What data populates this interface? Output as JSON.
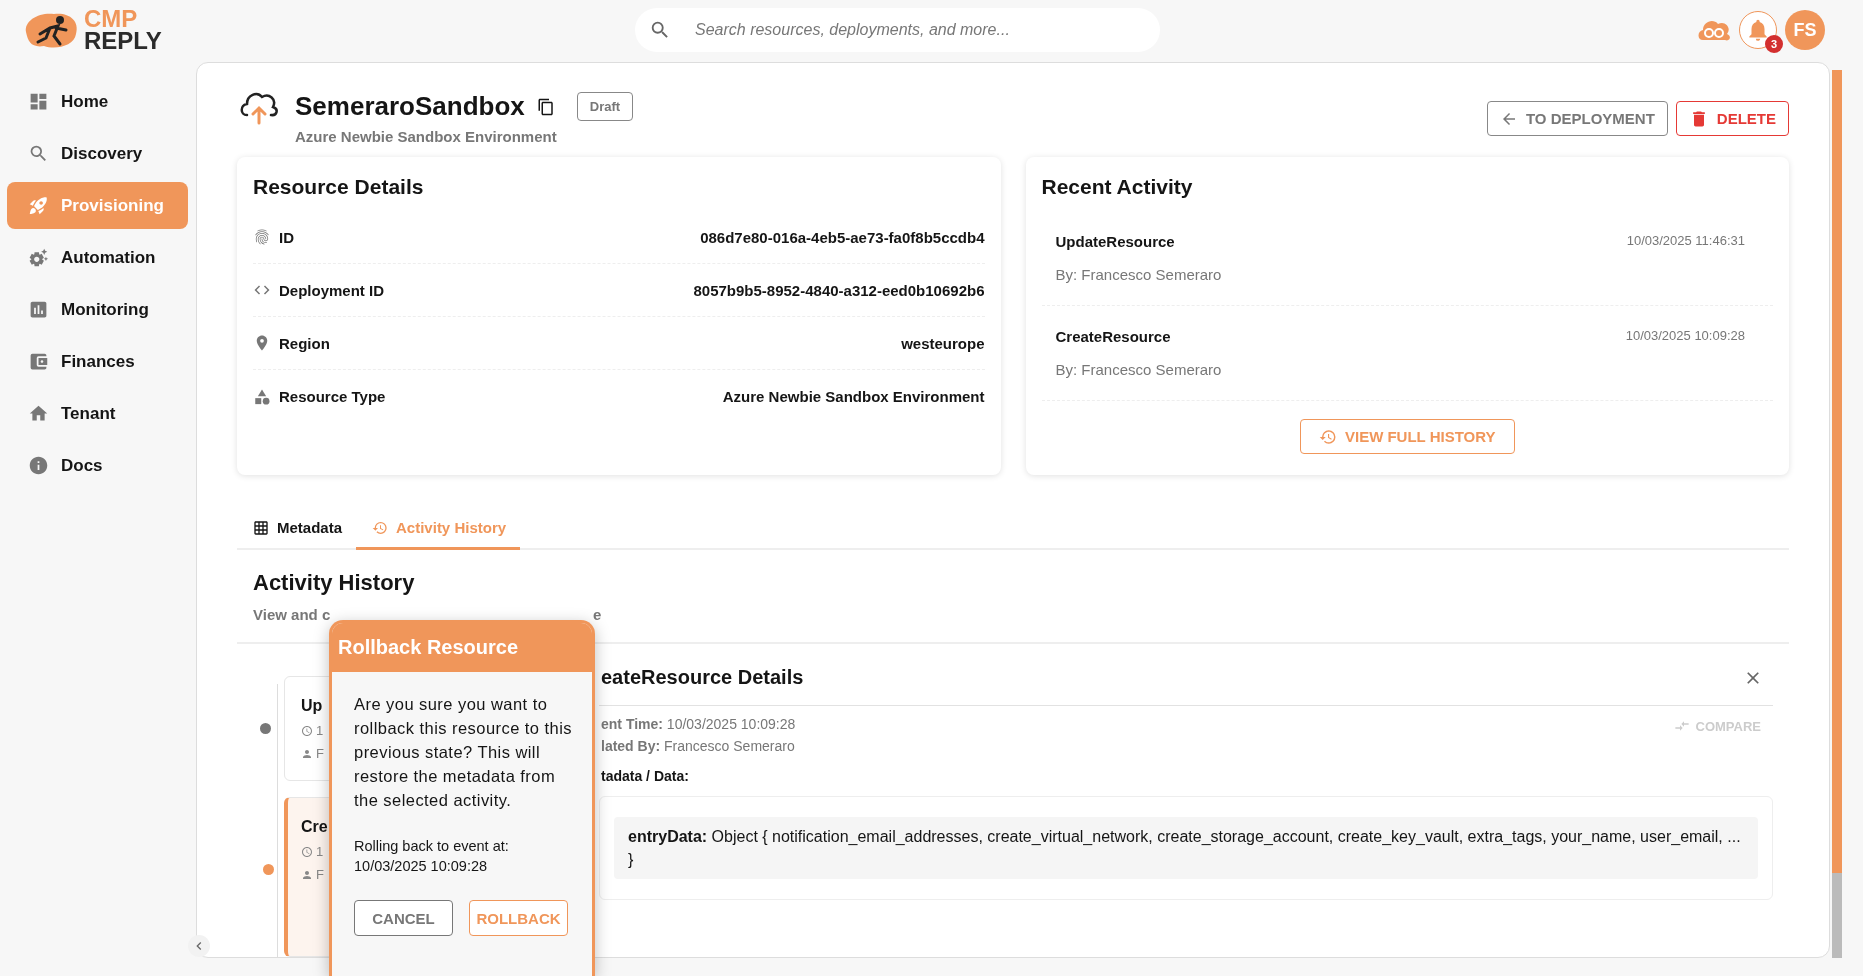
{
  "logo": {
    "top": "CMP",
    "bottom": "REPLY"
  },
  "search": {
    "placeholder": "Search resources, deployments, and more..."
  },
  "topbar": {
    "notification_count": "3",
    "avatar": "FS"
  },
  "sidebar": {
    "items": [
      {
        "label": "Home",
        "selected": false
      },
      {
        "label": "Discovery",
        "selected": false
      },
      {
        "label": "Provisioning",
        "selected": true
      },
      {
        "label": "Automation",
        "selected": false
      },
      {
        "label": "Monitoring",
        "selected": false
      },
      {
        "label": "Finances",
        "selected": false
      },
      {
        "label": "Tenant",
        "selected": false
      },
      {
        "label": "Docs",
        "selected": false
      }
    ]
  },
  "resource": {
    "title": "SemeraroSandbox",
    "status": "Draft",
    "subtitle": "Azure Newbie Sandbox Environment"
  },
  "actions": [
    {
      "label": "TO DEPLOYMENT",
      "kind": "back"
    },
    {
      "label": "DELETE",
      "kind": "danger"
    }
  ],
  "resource_details": {
    "title": "Resource Details",
    "rows": [
      {
        "label": "ID",
        "value": "086d7e80-016a-4eb5-ae73-fa0f8b5ccdb4"
      },
      {
        "label": "Deployment ID",
        "value": "8057b9b5-8952-4840-a312-eed0b10692b6"
      },
      {
        "label": "Region",
        "value": "westeurope"
      },
      {
        "label": "Resource Type",
        "value": "Azure Newbie Sandbox Environment"
      }
    ]
  },
  "recent_activity": {
    "title": "Recent Activity",
    "items": [
      {
        "name": "UpdateResource",
        "time": "10/03/2025 11:46:31",
        "by": "By: Francesco Semeraro"
      },
      {
        "name": "CreateResource",
        "time": "10/03/2025 10:09:28",
        "by": "By: Francesco Semeraro"
      }
    ],
    "button": "VIEW FULL HISTORY"
  },
  "tabs": [
    {
      "label": "Metadata",
      "selected": false
    },
    {
      "label": "Activity History",
      "selected": true
    }
  ],
  "activity_history": {
    "title": "Activity History",
    "subtitle_parts": [
      "View and c",
      "e"
    ],
    "timeline": [
      {
        "title": "Up",
        "time": "1",
        "user": "F",
        "selected": false
      },
      {
        "title": "Cre",
        "time": "1",
        "user": "F",
        "selected": true
      }
    ],
    "details": {
      "title": "eateResource Details",
      "event_time": "**ent Time:** 10/03/2025 10:09:28",
      "created_by": "**lated By:** Francesco Semeraro",
      "metadata_label": "tadata / Data:",
      "compare": {
        "label": "COMPARE",
        "disabled": true
      },
      "entry": "**entryData:** Object { notification_email_addresses, create_virtual_network, create_storage_account, create_key_vault, extra_tags, your_name, user_email, ... }"
    }
  },
  "dialog": {
    "title": "Rollback Resource",
    "message": "Are you sure you want to rollback this resource to this previous state? This will restore the metadata from the selected activity.",
    "event_label": "Rolling back to event at:",
    "event_time": "10/03/2025 10:09:28",
    "buttons": [
      {
        "label": "CANCEL",
        "kind": "secondary"
      },
      {
        "label": "ROLLBACK",
        "kind": "primary"
      }
    ]
  }
}
